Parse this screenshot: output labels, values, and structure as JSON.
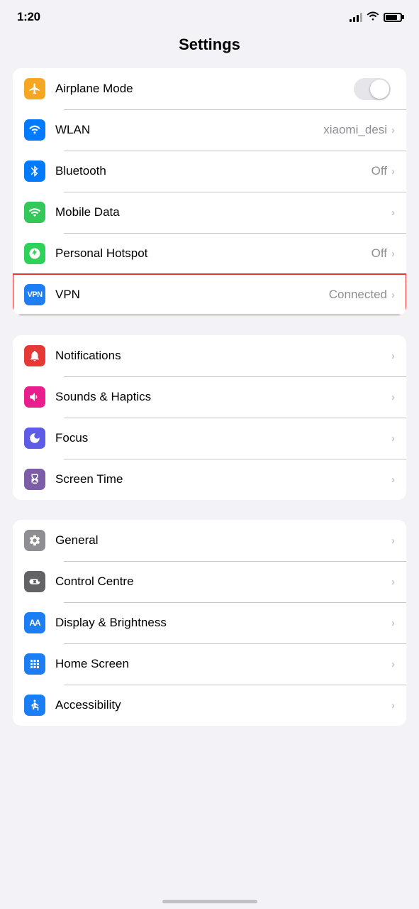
{
  "statusBar": {
    "time": "1:20"
  },
  "pageTitle": "Settings",
  "groups": [
    {
      "id": "network",
      "items": [
        {
          "id": "airplane-mode",
          "label": "Airplane Mode",
          "iconBg": "bg-orange",
          "iconType": "plane",
          "valueText": "",
          "hasToggle": true,
          "toggleOn": false,
          "hasChevron": false,
          "highlighted": false
        },
        {
          "id": "wlan",
          "label": "WLAN",
          "iconBg": "bg-blue",
          "iconType": "wifi",
          "valueText": "xiaomi_desi",
          "hasToggle": false,
          "hasChevron": true,
          "highlighted": false
        },
        {
          "id": "bluetooth",
          "label": "Bluetooth",
          "iconBg": "bg-bluetooth",
          "iconType": "bluetooth",
          "valueText": "Off",
          "hasToggle": false,
          "hasChevron": true,
          "highlighted": false
        },
        {
          "id": "mobile-data",
          "label": "Mobile Data",
          "iconBg": "bg-green",
          "iconType": "mobile-data",
          "valueText": "",
          "hasToggle": false,
          "hasChevron": true,
          "highlighted": false
        },
        {
          "id": "personal-hotspot",
          "label": "Personal Hotspot",
          "iconBg": "bg-green2",
          "iconType": "hotspot",
          "valueText": "Off",
          "hasToggle": false,
          "hasChevron": true,
          "highlighted": false
        },
        {
          "id": "vpn",
          "label": "VPN",
          "iconBg": "bg-vpn",
          "iconType": "vpn",
          "valueText": "Connected",
          "hasToggle": false,
          "hasChevron": true,
          "highlighted": true
        }
      ]
    },
    {
      "id": "notifications",
      "items": [
        {
          "id": "notifications",
          "label": "Notifications",
          "iconBg": "bg-red",
          "iconType": "bell",
          "valueText": "",
          "hasToggle": false,
          "hasChevron": true,
          "highlighted": false
        },
        {
          "id": "sounds-haptics",
          "label": "Sounds & Haptics",
          "iconBg": "bg-pink",
          "iconType": "sound",
          "valueText": "",
          "hasToggle": false,
          "hasChevron": true,
          "highlighted": false
        },
        {
          "id": "focus",
          "label": "Focus",
          "iconBg": "bg-purple",
          "iconType": "moon",
          "valueText": "",
          "hasToggle": false,
          "hasChevron": true,
          "highlighted": false
        },
        {
          "id": "screen-time",
          "label": "Screen Time",
          "iconBg": "bg-purple2",
          "iconType": "hourglass",
          "valueText": "",
          "hasToggle": false,
          "hasChevron": true,
          "highlighted": false
        }
      ]
    },
    {
      "id": "general-settings",
      "items": [
        {
          "id": "general",
          "label": "General",
          "iconBg": "bg-gray",
          "iconType": "gear",
          "valueText": "",
          "hasToggle": false,
          "hasChevron": true,
          "highlighted": false
        },
        {
          "id": "control-centre",
          "label": "Control Centre",
          "iconBg": "bg-gray2",
          "iconType": "toggles",
          "valueText": "",
          "hasToggle": false,
          "hasChevron": true,
          "highlighted": false
        },
        {
          "id": "display-brightness",
          "label": "Display & Brightness",
          "iconBg": "bg-blueaa",
          "iconType": "aa",
          "valueText": "",
          "hasToggle": false,
          "hasChevron": true,
          "highlighted": false
        },
        {
          "id": "home-screen",
          "label": "Home Screen",
          "iconBg": "bg-homescreen",
          "iconType": "grid",
          "valueText": "",
          "hasToggle": false,
          "hasChevron": true,
          "highlighted": false
        },
        {
          "id": "accessibility",
          "label": "Accessibility",
          "iconBg": "bg-accessibility",
          "iconType": "accessibility",
          "valueText": "",
          "hasToggle": false,
          "hasChevron": true,
          "highlighted": false
        }
      ]
    }
  ]
}
